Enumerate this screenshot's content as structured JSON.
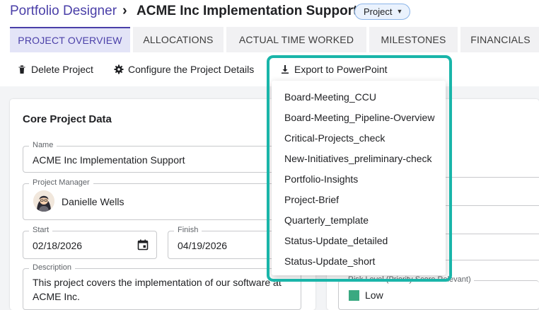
{
  "header": {
    "app_title": "Portfolio Designer",
    "separator": "›",
    "project_title": "ACME Inc Implementation Support",
    "type_chip": "Project"
  },
  "tabs": [
    {
      "label": "PROJECT OVERVIEW",
      "active": true
    },
    {
      "label": "ALLOCATIONS"
    },
    {
      "label": "ACTUAL TIME WORKED"
    },
    {
      "label": "MILESTONES"
    },
    {
      "label": "FINANCIALS"
    },
    {
      "label": ""
    }
  ],
  "toolbar": {
    "delete_label": "Delete Project",
    "configure_label": "Configure the Project Details",
    "export_label": "Export to PowerPoint"
  },
  "core": {
    "title": "Core Project Data",
    "name_label": "Name",
    "name_value": "ACME Inc Implementation Support",
    "pm_label": "Project Manager",
    "pm_value": "Danielle Wells",
    "start_label": "Start",
    "start_value": "02/18/2026",
    "finish_label": "Finish",
    "finish_value": "04/19/2026",
    "description_label": "Description",
    "description_value": "This project covers the implementation of our software at ACME Inc."
  },
  "risk": {
    "label": "Risk Level (Priority Score Relevant)",
    "value": "Low",
    "color": "#3aa981"
  },
  "export_menu": {
    "items": [
      "Board-Meeting_CCU",
      "Board-Meeting_Pipeline-Overview",
      "Critical-Projects_check",
      "New-Initiatives_preliminary-check",
      "Portfolio-Insights",
      "Project-Brief",
      "Quarterly_template",
      "Status-Update_detailed",
      "Status-Update_short"
    ]
  },
  "colors": {
    "brand": "#4a3fa8",
    "highlight": "#19b5a9"
  }
}
